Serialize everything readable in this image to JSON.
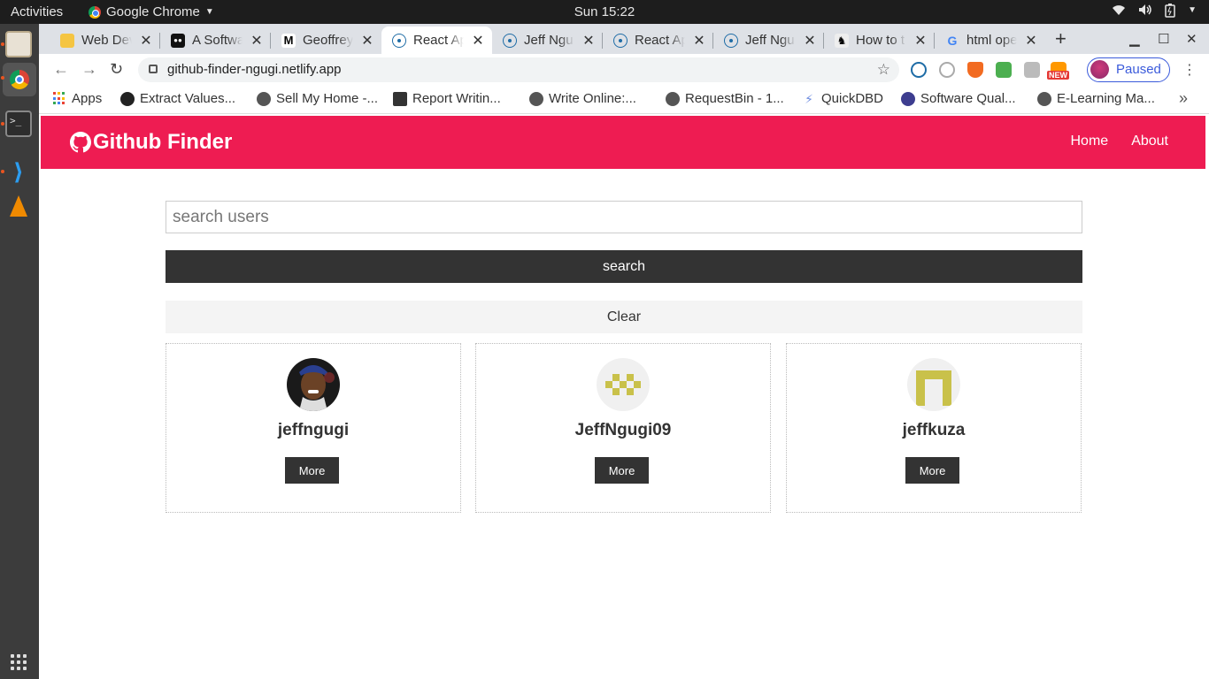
{
  "system": {
    "activities": "Activities",
    "app_name": "Google Chrome",
    "clock": "Sun 15:22"
  },
  "tabs": [
    {
      "title": "Web Dev",
      "active": false
    },
    {
      "title": "A Softwa",
      "active": false
    },
    {
      "title": "Geoffrey",
      "active": false
    },
    {
      "title": "React Ap",
      "active": true
    },
    {
      "title": "Jeff Ngu",
      "active": false
    },
    {
      "title": "React Ap",
      "active": false
    },
    {
      "title": "Jeff Ngu",
      "active": false
    },
    {
      "title": "How to t",
      "active": false
    },
    {
      "title": "html ope",
      "active": false
    }
  ],
  "address_bar": {
    "url": "github-finder-ngugi.netlify.app"
  },
  "profile": {
    "label": "Paused"
  },
  "new_badge": "NEW",
  "bookmarks": [
    {
      "label": "Apps"
    },
    {
      "label": "Extract Values..."
    },
    {
      "label": "Sell My Home -..."
    },
    {
      "label": "Report Writin..."
    },
    {
      "label": "Write Online:..."
    },
    {
      "label": "RequestBin - 1..."
    },
    {
      "label": "QuickDBD"
    },
    {
      "label": "Software Qual..."
    },
    {
      "label": "E-Learning Ma..."
    }
  ],
  "app": {
    "brand": "Github Finder",
    "nav": {
      "home": "Home",
      "about": "About"
    },
    "search": {
      "placeholder": "search users",
      "value": ""
    },
    "search_button": "search",
    "clear_button": "Clear",
    "users": [
      {
        "login": "jeffngugi",
        "button": "More"
      },
      {
        "login": "JeffNgugi09",
        "button": "More"
      },
      {
        "login": "jeffkuza",
        "button": "More"
      }
    ]
  },
  "colors": {
    "navbar": "#ee1c52",
    "dark_button": "#333333",
    "light_button": "#f4f4f4",
    "identicon": "#c9c14a"
  }
}
